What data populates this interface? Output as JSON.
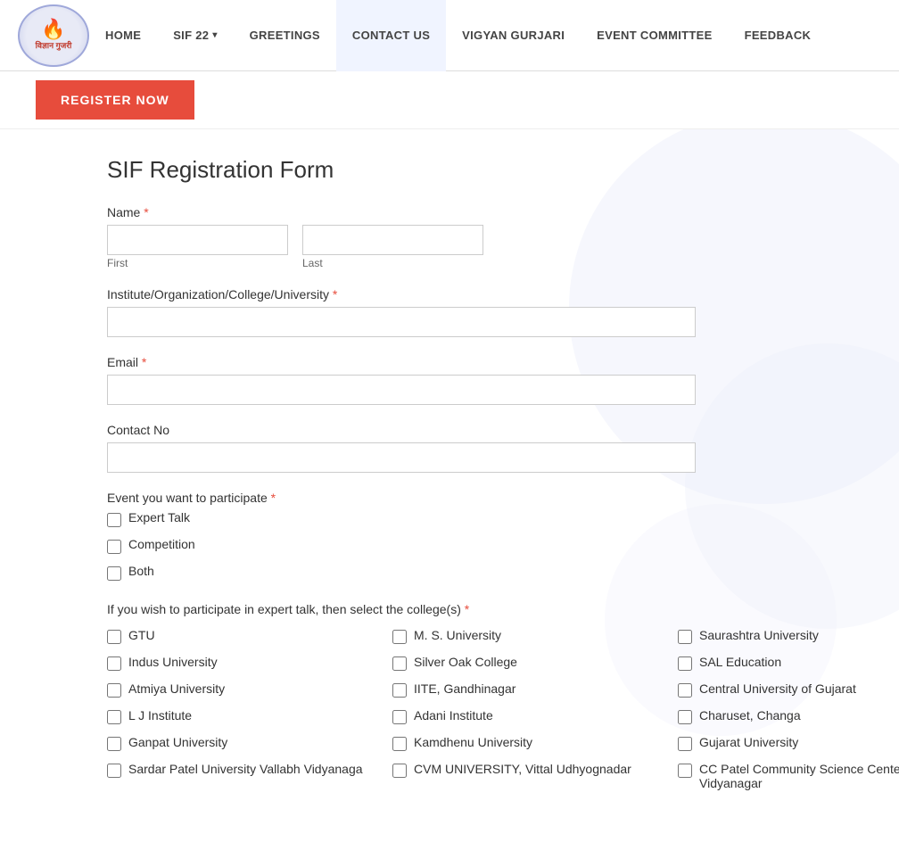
{
  "nav": {
    "logo_text": "विज्ञान गुजरी",
    "links": [
      {
        "id": "home",
        "label": "HOME",
        "dropdown": false
      },
      {
        "id": "sif22",
        "label": "SIF 22",
        "dropdown": true
      },
      {
        "id": "greetings",
        "label": "GREETINGS",
        "dropdown": false
      },
      {
        "id": "contact",
        "label": "CONTACT US",
        "dropdown": false
      },
      {
        "id": "vigyan",
        "label": "VIGYAN GURJARI",
        "dropdown": false
      },
      {
        "id": "event",
        "label": "EVENT COMMITTEE",
        "dropdown": false
      },
      {
        "id": "feedback",
        "label": "FEEDBACK",
        "dropdown": false
      }
    ],
    "register_button": "REGISTER NOW"
  },
  "form": {
    "title": "SIF Registration Form",
    "name_label": "Name",
    "name_first_label": "First",
    "name_last_label": "Last",
    "institute_label": "Institute/Organization/College/University",
    "email_label": "Email",
    "contact_label": "Contact No",
    "event_label": "Event you want to participate",
    "event_options": [
      {
        "id": "expert-talk",
        "label": "Expert Talk"
      },
      {
        "id": "competition",
        "label": "Competition"
      },
      {
        "id": "both",
        "label": "Both"
      }
    ],
    "college_section_label": "If you wish to participate in expert talk, then select the college(s)",
    "colleges_col1": [
      {
        "id": "gtu",
        "label": "GTU"
      },
      {
        "id": "indus",
        "label": "Indus University"
      },
      {
        "id": "atmiya",
        "label": "Atmiya University"
      },
      {
        "id": "lj",
        "label": "L J Institute"
      },
      {
        "id": "ganpat",
        "label": "Ganpat University"
      },
      {
        "id": "sardar",
        "label": "Sardar Patel University Vallabh Vidyanaga"
      }
    ],
    "colleges_col2": [
      {
        "id": "ms-university",
        "label": "M. S. University"
      },
      {
        "id": "silver-oak",
        "label": "Silver Oak College"
      },
      {
        "id": "iite",
        "label": "IITE, Gandhinagar"
      },
      {
        "id": "adani",
        "label": "Adani Institute"
      },
      {
        "id": "kamdhenu",
        "label": "Kamdhenu University"
      },
      {
        "id": "cvm",
        "label": "CVM UNIVERSITY, Vittal Udhyognadar"
      }
    ],
    "colleges_col3": [
      {
        "id": "saurashtra",
        "label": "Saurashtra University"
      },
      {
        "id": "sal",
        "label": "SAL Education"
      },
      {
        "id": "central-gujarat",
        "label": "Central University of Gujarat"
      },
      {
        "id": "charuset",
        "label": "Charuset, Changa"
      },
      {
        "id": "gujarat-university",
        "label": "Gujarat University"
      },
      {
        "id": "cc-patel",
        "label": "CC Patel Community Science Center, Vallabh Vidyanagar"
      }
    ]
  }
}
